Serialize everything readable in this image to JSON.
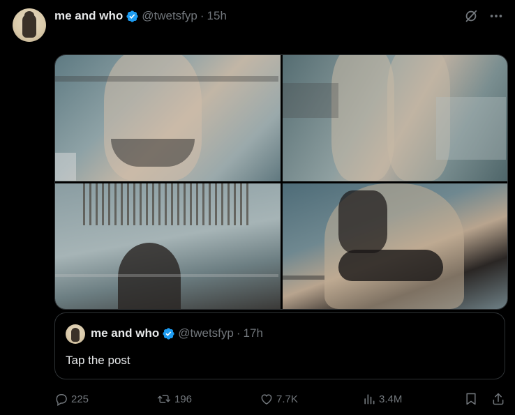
{
  "post": {
    "display_name": "me and who",
    "handle": "@twetsfyp",
    "separator": "·",
    "time": "15h"
  },
  "quote": {
    "display_name": "me and who",
    "handle": "@twetsfyp",
    "separator": "·",
    "time": "17h",
    "text": "Tap the post"
  },
  "actions": {
    "replies": "225",
    "reposts": "196",
    "likes": "7.7K",
    "views": "3.4M"
  },
  "icons": {
    "verified": "verified-badge-icon",
    "grok": "grok-icon",
    "more": "more-icon",
    "reply": "reply-icon",
    "repost": "repost-icon",
    "like": "like-icon",
    "views": "views-icon",
    "bookmark": "bookmark-icon",
    "share": "share-icon"
  },
  "colors": {
    "background": "#000000",
    "text": "#e7e9ea",
    "secondary": "#71767b",
    "verified": "#1d9bf0",
    "border": "#2f3336"
  }
}
